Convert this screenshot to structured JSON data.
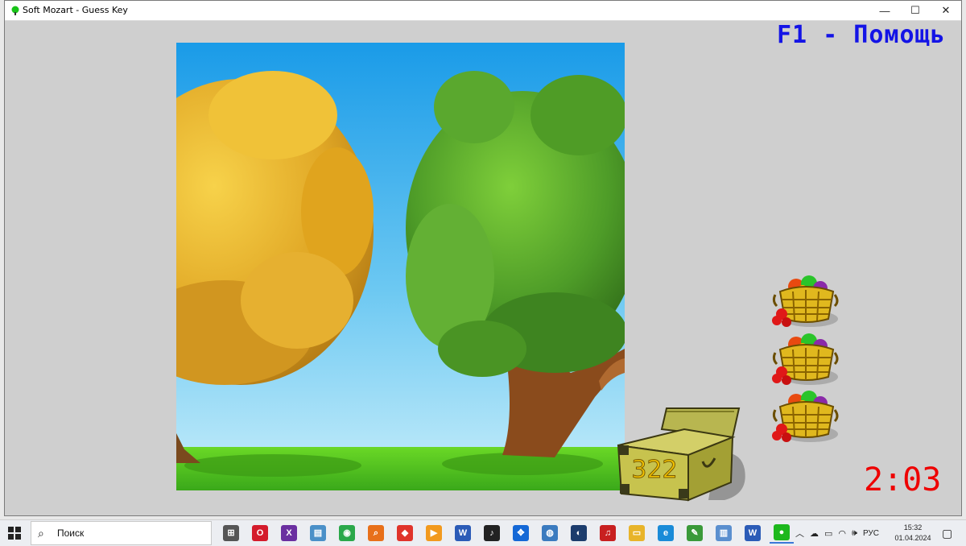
{
  "window": {
    "title": "Soft Mozart - Guess Key",
    "controls": {
      "minimize": "—",
      "maximize": "☐",
      "close": "✕"
    }
  },
  "game": {
    "help_hint": "F1 - Помощь",
    "chest_count": "322",
    "baskets_remaining": 3,
    "timer": "2:03"
  },
  "colors": {
    "help_text": "#1414e6",
    "timer_text": "#ee0000",
    "sky_top": "#1a9be8",
    "grass": "#4fc21b"
  },
  "taskbar": {
    "search_placeholder": "Поиск",
    "apps": [
      {
        "name": "task-view",
        "glyph": "⊞",
        "color": "#555555"
      },
      {
        "name": "opera",
        "glyph": "O",
        "color": "#d41b2b"
      },
      {
        "name": "xmind",
        "glyph": "X",
        "color": "#6a2fa0"
      },
      {
        "name": "notes",
        "glyph": "▤",
        "color": "#4a90c8"
      },
      {
        "name": "chrome",
        "glyph": "◉",
        "color": "#2aa84a"
      },
      {
        "name": "search-tool",
        "glyph": "⌕",
        "color": "#e8701a"
      },
      {
        "name": "anydesk",
        "glyph": "◆",
        "color": "#e0342b"
      },
      {
        "name": "media-player",
        "glyph": "▶",
        "color": "#f29a1e"
      },
      {
        "name": "word",
        "glyph": "W",
        "color": "#2b5bb7"
      },
      {
        "name": "piano-app",
        "glyph": "♪",
        "color": "#222222"
      },
      {
        "name": "dropbox",
        "glyph": "✥",
        "color": "#1468d6"
      },
      {
        "name": "globe-app",
        "glyph": "◍",
        "color": "#3b7bbf"
      },
      {
        "name": "monitor-app",
        "glyph": "◐",
        "color": "#1c3c6c"
      },
      {
        "name": "music-app",
        "glyph": "♫",
        "color": "#c82020"
      },
      {
        "name": "file-explorer",
        "glyph": "▭",
        "color": "#e8b42a"
      },
      {
        "name": "edge",
        "glyph": "e",
        "color": "#1a8bd8"
      },
      {
        "name": "paint",
        "glyph": "✎",
        "color": "#3a9a3a"
      },
      {
        "name": "notepad",
        "glyph": "▥",
        "color": "#5a8fcf"
      },
      {
        "name": "word-doc",
        "glyph": "W",
        "color": "#2b5bb7"
      },
      {
        "name": "soft-mozart",
        "glyph": "●",
        "color": "#1db81d",
        "active": true
      }
    ],
    "language": "РУС",
    "time": "15:32",
    "date": "01.04.2024"
  }
}
